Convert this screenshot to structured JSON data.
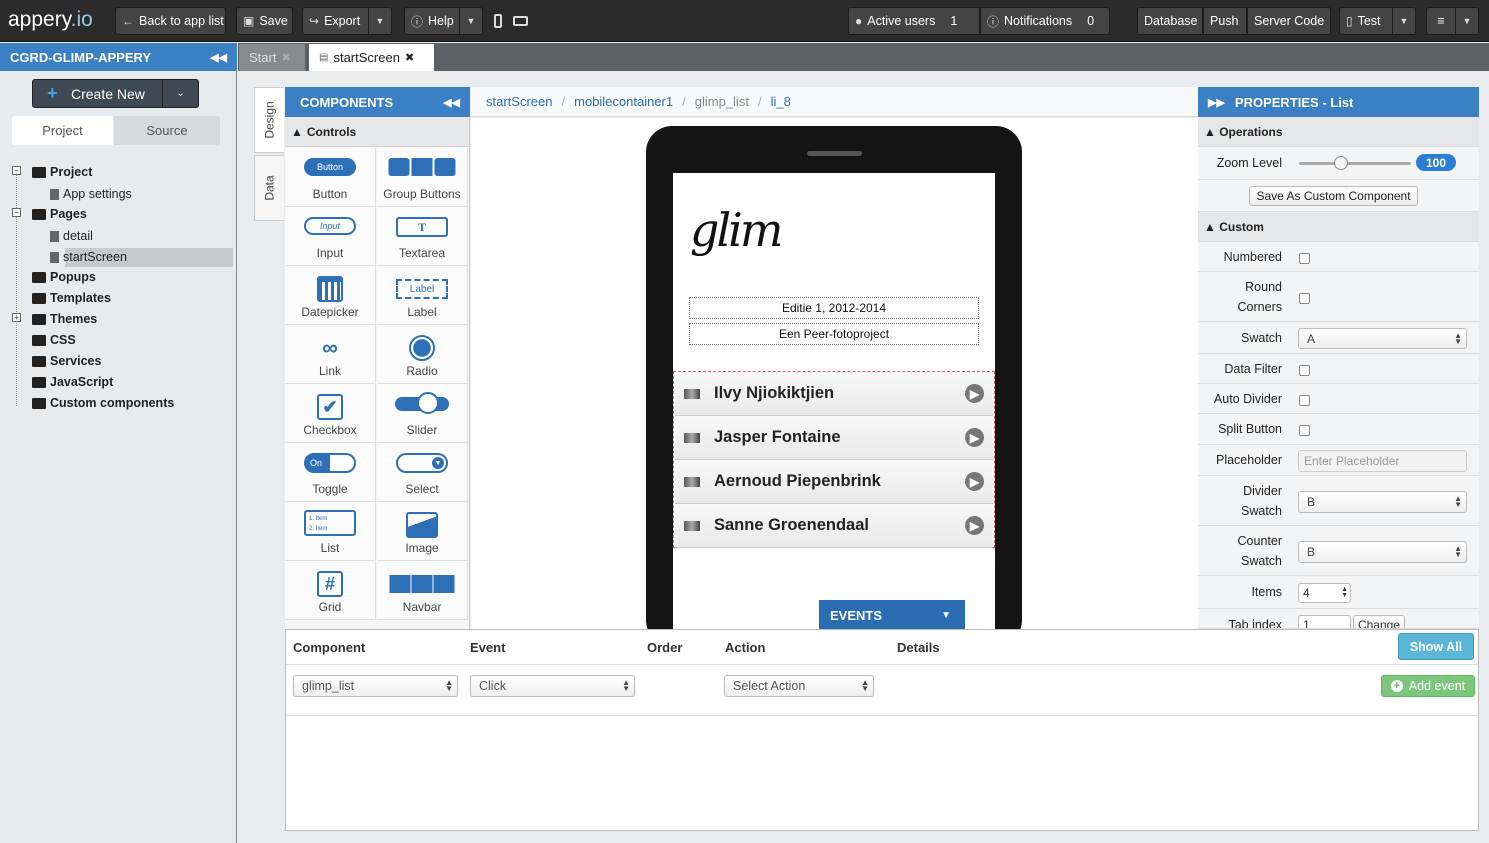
{
  "app": {
    "logo_main": "appery",
    "logo_tld": ".io"
  },
  "topbar": {
    "back": "Back to app list",
    "save": "Save",
    "export": "Export",
    "help": "Help",
    "active_users_label": "Active users",
    "active_users_count": "1",
    "notifications_label": "Notifications",
    "notifications_count": "0",
    "database": "Database",
    "push": "Push",
    "server_code": "Server Code",
    "test": "Test"
  },
  "left": {
    "project_name": "CGRD-GLIMP-APPERY",
    "create_new": "Create New",
    "tabs": [
      "Project",
      "Source"
    ],
    "tree": {
      "project": "Project",
      "app_settings": "App settings",
      "pages": "Pages",
      "detail": "detail",
      "start_screen": "startScreen",
      "popups": "Popups",
      "templates": "Templates",
      "themes": "Themes",
      "css": "CSS",
      "services": "Services",
      "javascript": "JavaScript",
      "custom_components": "Custom components"
    }
  },
  "doc_tabs": {
    "start": "Start",
    "start_screen": "startScreen"
  },
  "side_tabs": {
    "design": "Design",
    "data": "Data"
  },
  "components": {
    "header": "COMPONENTS",
    "section": "Controls",
    "items": [
      "Button",
      "Group Buttons",
      "Input",
      "Textarea",
      "Datepicker",
      "Label",
      "Link",
      "Radio",
      "Checkbox",
      "Slider",
      "Toggle",
      "Select",
      "List",
      "Image",
      "Grid",
      "Navbar"
    ],
    "icon_text": {
      "button": "Button",
      "input": "Input",
      "textarea": "T",
      "label": "Label",
      "toggle": "On",
      "list1": "1. Item",
      "list2": "2. Item"
    }
  },
  "breadcrumb": [
    "startScreen",
    "mobilecontainer1",
    "glimp_list",
    "li_8"
  ],
  "screen": {
    "logo_text": "glim",
    "edition": "Editie 1, 2012-2014",
    "subtitle": "Een Peer-fotoproject",
    "list_items": [
      "Ilvy Njiokiktjien",
      "Jasper Fontaine",
      "Aernoud Piepenbrink",
      "Sanne Groenendaal"
    ],
    "events_button": "EVENTS"
  },
  "properties": {
    "header": "PROPERTIES - List",
    "operations": "Operations",
    "zoom_label": "Zoom Level",
    "zoom_value": "100",
    "save_custom": "Save As Custom Component",
    "custom": "Custom",
    "numbered": "Numbered",
    "round_corners": [
      "Round",
      "Corners"
    ],
    "swatch": "Swatch",
    "swatch_value": "A",
    "data_filter": "Data Filter",
    "auto_divider": "Auto Divider",
    "split_button": "Split Button",
    "placeholder": "Placeholder",
    "placeholder_hint": "Enter Placeholder",
    "divider_swatch": [
      "Divider",
      "Swatch"
    ],
    "divider_swatch_value": "B",
    "counter_swatch": [
      "Counter",
      "Swatch"
    ],
    "counter_swatch_value": "B",
    "items": "Items",
    "items_value": "4",
    "tab_index": "Tab index",
    "tab_index_value": "1",
    "change": "Change"
  },
  "events_panel": {
    "columns": [
      "Component",
      "Event",
      "Order",
      "Action",
      "Details"
    ],
    "show_all": "Show All",
    "component_value": "glimp_list",
    "event_value": "Click",
    "action_value": "Select Action",
    "add_event": "Add event"
  },
  "colors": {
    "accent": "#3b7fc4",
    "topbar": "#2b2b2b",
    "events": "#2a6db5",
    "add_event": "#5cb85c",
    "show_all": "#5bb5d6"
  }
}
